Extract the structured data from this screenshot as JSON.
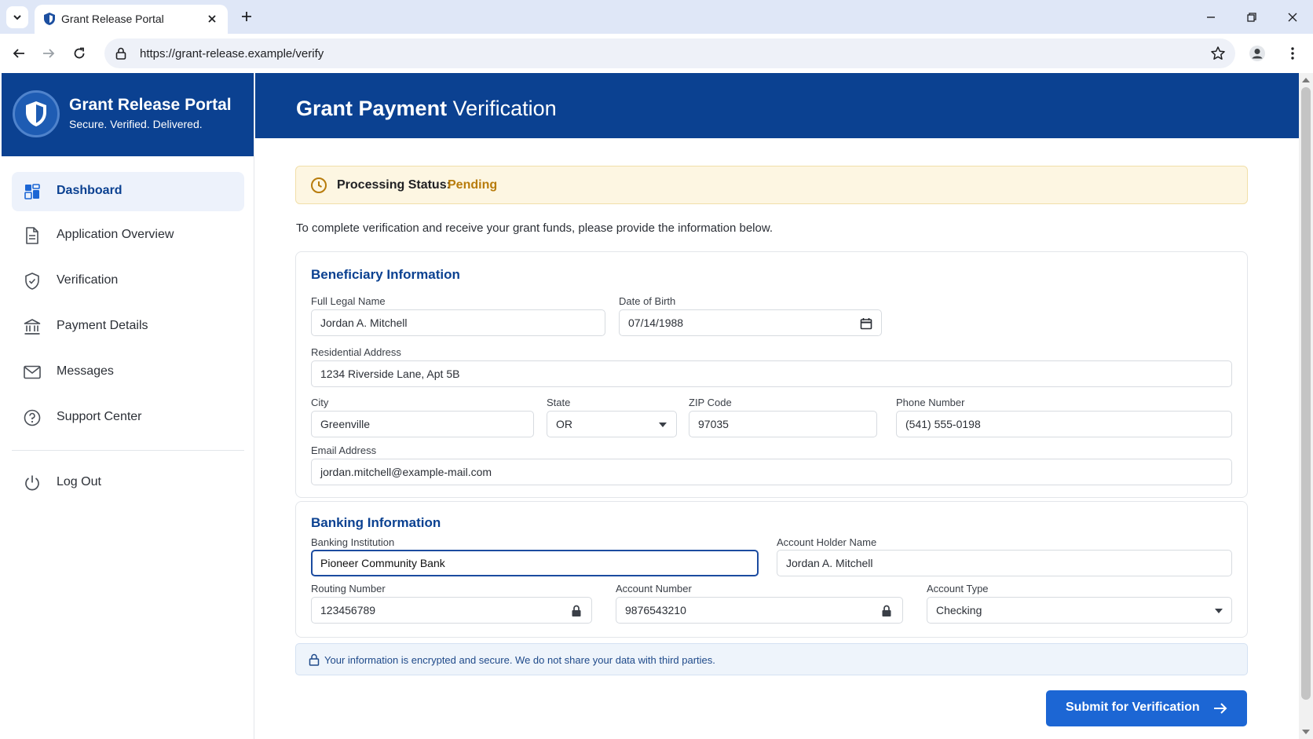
{
  "browser": {
    "tab_title": "Grant Release Portal",
    "url": "https://grant-release.example/verify"
  },
  "sidebar": {
    "brand_title": "Grant Release Portal",
    "brand_tagline": "Secure. Verified. Delivered.",
    "items": [
      {
        "label": "Dashboard",
        "icon": "dashboard-icon",
        "active": true
      },
      {
        "label": "Application Overview",
        "icon": "document-icon",
        "active": false
      },
      {
        "label": "Verification",
        "icon": "shield-check-icon",
        "active": false
      },
      {
        "label": "Payment Details",
        "icon": "bank-icon",
        "active": false
      },
      {
        "label": "Messages",
        "icon": "mail-icon",
        "active": false
      },
      {
        "label": "Support Center",
        "icon": "help-icon",
        "active": false
      }
    ],
    "logout_label": "Log Out"
  },
  "header": {
    "title_bold": "Grant Payment",
    "title_rest": " Verification"
  },
  "status": {
    "label": "Processing Status:",
    "value": "Pending"
  },
  "intro_text": "To complete verification and receive your grant funds, please provide the information below.",
  "beneficiary": {
    "title": "Beneficiary Information",
    "full_name_label": "Full Legal Name",
    "full_name": "Jordan A. Mitchell",
    "dob_label": "Date of Birth",
    "dob": "07/14/1988",
    "address_label": "Residential Address",
    "address": "1234 Riverside Lane, Apt 5B",
    "city_label": "City",
    "city": "Greenville",
    "state_label": "State",
    "state": "OR",
    "zip_label": "ZIP Code",
    "zip": "97035",
    "phone_label": "Phone Number",
    "phone": "(541) 555-0198",
    "email_label": "Email Address",
    "email": "jordan.mitchell@example-mail.com"
  },
  "banking": {
    "title": "Banking Information",
    "institution_label": "Banking Institution",
    "institution": "Pioneer Community Bank",
    "holder_label": "Account Holder Name",
    "holder": "Jordan A. Mitchell",
    "routing_label": "Routing Number",
    "routing": "123456789",
    "account_label": "Account Number",
    "account": "9876543210",
    "type_label": "Account Type",
    "type": "Checking"
  },
  "secure_note": "Your information is encrypted and secure. We do not share your data with third parties.",
  "submit_label": "Submit for Verification",
  "colors": {
    "brand_navy": "#0b4191",
    "accent_blue": "#1c66d4",
    "pending_amber": "#b87c0c"
  }
}
